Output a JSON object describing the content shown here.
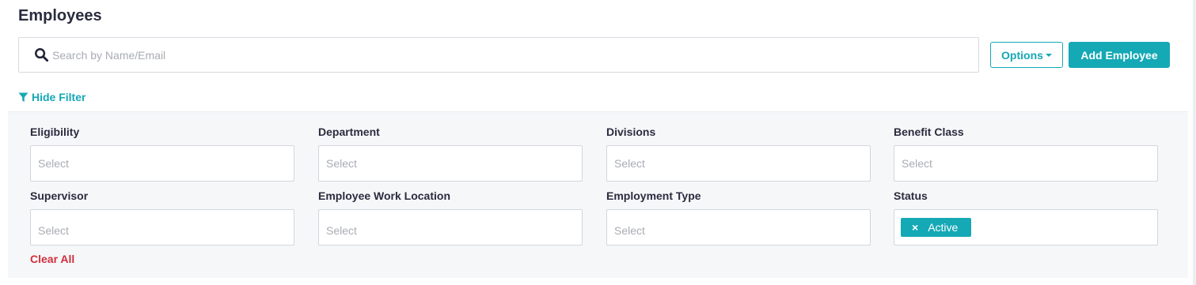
{
  "page": {
    "title": "Employees"
  },
  "search": {
    "placeholder": "Search by Name/Email",
    "value": ""
  },
  "toolbar": {
    "options_label": "Options",
    "add_label": "Add Employee"
  },
  "filter_toggle": {
    "label": "Hide Filter"
  },
  "filters": {
    "eligibility": {
      "label": "Eligibility",
      "placeholder": "Select"
    },
    "department": {
      "label": "Department",
      "placeholder": "Select"
    },
    "divisions": {
      "label": "Divisions",
      "placeholder": "Select"
    },
    "benefit_class": {
      "label": "Benefit Class",
      "placeholder": "Select"
    },
    "supervisor": {
      "label": "Supervisor",
      "placeholder": "Select"
    },
    "work_location": {
      "label": "Employee Work Location",
      "placeholder": "Select"
    },
    "employment_type": {
      "label": "Employment Type",
      "placeholder": "Select"
    },
    "status": {
      "label": "Status",
      "selected": [
        {
          "label": "Active",
          "remove": "×"
        }
      ]
    }
  },
  "clear_all": {
    "label": "Clear All"
  },
  "colors": {
    "accent": "#15a8b5",
    "danger": "#d0303b",
    "panel_bg": "#f6f7f9",
    "title": "#2a2c3f"
  }
}
